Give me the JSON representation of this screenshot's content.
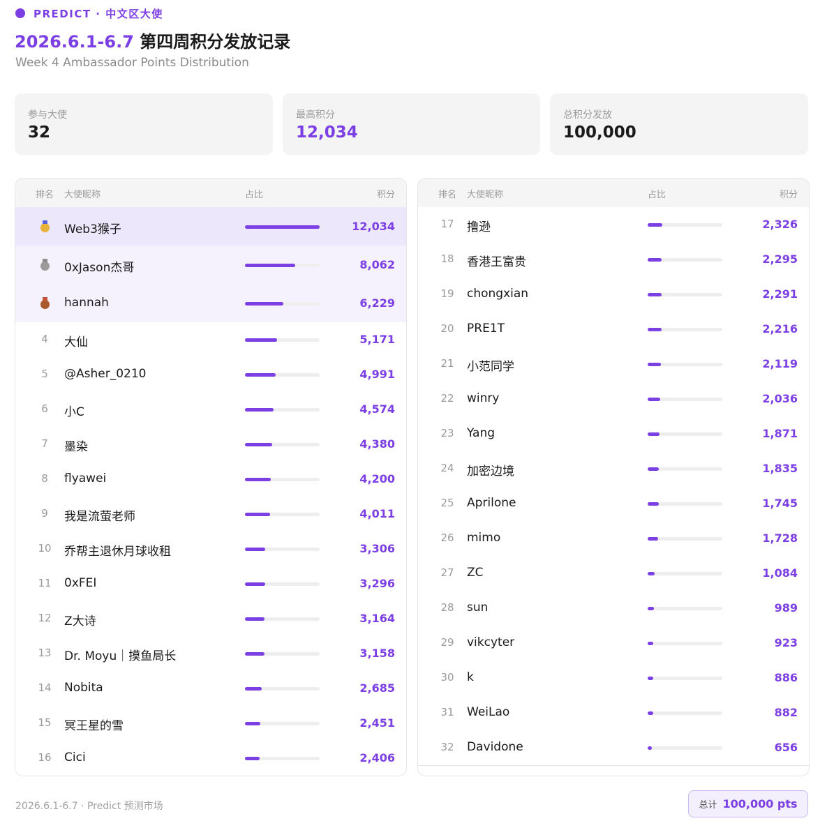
{
  "header": {
    "brand": "PREDICT · 中文区大使",
    "title_accent": "2026.6.1-6.7",
    "title_rest": " 第四周积分发放记录",
    "subtitle": "Week 4 Ambassador Points Distribution"
  },
  "stats": [
    {
      "label": "参与大使",
      "value": "32"
    },
    {
      "label": "最高积分",
      "value": "12,034"
    },
    {
      "label": "总积分发放",
      "value": "100,000"
    }
  ],
  "table_headers": {
    "rank": "排名",
    "name": "大使昵称",
    "share": "占比",
    "points": "积分"
  },
  "ranking": [
    {
      "rank": "1",
      "name": "Web3猴子",
      "points": 12034,
      "points_label": "12,034"
    },
    {
      "rank": "2",
      "name": "0xJason杰哥",
      "points": 8062,
      "points_label": "8,062"
    },
    {
      "rank": "3",
      "name": "hannah",
      "points": 6229,
      "points_label": "6,229"
    },
    {
      "rank": "4",
      "name": "大仙",
      "points": 5171,
      "points_label": "5,171"
    },
    {
      "rank": "5",
      "name": "@Asher_0210",
      "points": 4991,
      "points_label": "4,991"
    },
    {
      "rank": "6",
      "name": "小C",
      "points": 4574,
      "points_label": "4,574"
    },
    {
      "rank": "7",
      "name": "墨染",
      "points": 4380,
      "points_label": "4,380"
    },
    {
      "rank": "8",
      "name": "flyawei",
      "points": 4200,
      "points_label": "4,200"
    },
    {
      "rank": "9",
      "name": "我是流萤老师",
      "points": 4011,
      "points_label": "4,011"
    },
    {
      "rank": "10",
      "name": "乔帮主退休月球收租",
      "points": 3306,
      "points_label": "3,306"
    },
    {
      "rank": "11",
      "name": "0xFEI",
      "points": 3296,
      "points_label": "3,296"
    },
    {
      "rank": "12",
      "name": "Z大诗",
      "points": 3164,
      "points_label": "3,164"
    },
    {
      "rank": "13",
      "name": "Dr. Moyu｜摸鱼局长",
      "points": 3158,
      "points_label": "3,158"
    },
    {
      "rank": "14",
      "name": "Nobita",
      "points": 2685,
      "points_label": "2,685"
    },
    {
      "rank": "15",
      "name": "冥王星的雪",
      "points": 2451,
      "points_label": "2,451"
    },
    {
      "rank": "16",
      "name": "Cici",
      "points": 2406,
      "points_label": "2,406"
    },
    {
      "rank": "17",
      "name": "撸逊",
      "points": 2326,
      "points_label": "2,326"
    },
    {
      "rank": "18",
      "name": "香港王富贵",
      "points": 2295,
      "points_label": "2,295"
    },
    {
      "rank": "19",
      "name": "chongxian",
      "points": 2291,
      "points_label": "2,291"
    },
    {
      "rank": "20",
      "name": "PRE1T",
      "points": 2216,
      "points_label": "2,216"
    },
    {
      "rank": "21",
      "name": "小范同学",
      "points": 2119,
      "points_label": "2,119"
    },
    {
      "rank": "22",
      "name": "winry",
      "points": 2036,
      "points_label": "2,036"
    },
    {
      "rank": "23",
      "name": "Yang",
      "points": 1871,
      "points_label": "1,871"
    },
    {
      "rank": "24",
      "name": "加密边境",
      "points": 1835,
      "points_label": "1,835"
    },
    {
      "rank": "25",
      "name": "Aprilone",
      "points": 1745,
      "points_label": "1,745"
    },
    {
      "rank": "26",
      "name": "mimo",
      "points": 1728,
      "points_label": "1,728"
    },
    {
      "rank": "27",
      "name": "ZC",
      "points": 1084,
      "points_label": "1,084"
    },
    {
      "rank": "28",
      "name": "sun",
      "points": 989,
      "points_label": "989"
    },
    {
      "rank": "29",
      "name": "vikcyter",
      "points": 923,
      "points_label": "923"
    },
    {
      "rank": "30",
      "name": "k",
      "points": 886,
      "points_label": "886"
    },
    {
      "rank": "31",
      "name": "WeiLao",
      "points": 882,
      "points_label": "882"
    },
    {
      "rank": "32",
      "name": "Davidone",
      "points": 656,
      "points_label": "656"
    }
  ],
  "medals": [
    "gold-medal-icon",
    "silver-medal-icon",
    "bronze-medal-icon"
  ],
  "footer": {
    "text": "2026.6.1-6.7 · Predict 预测市场",
    "total_label": "总计",
    "total_value": "100,000 pts"
  },
  "colors": {
    "accent": "#7b3fe4",
    "top1_row": "#ece7fb",
    "top_row": "#f5f2fd"
  }
}
